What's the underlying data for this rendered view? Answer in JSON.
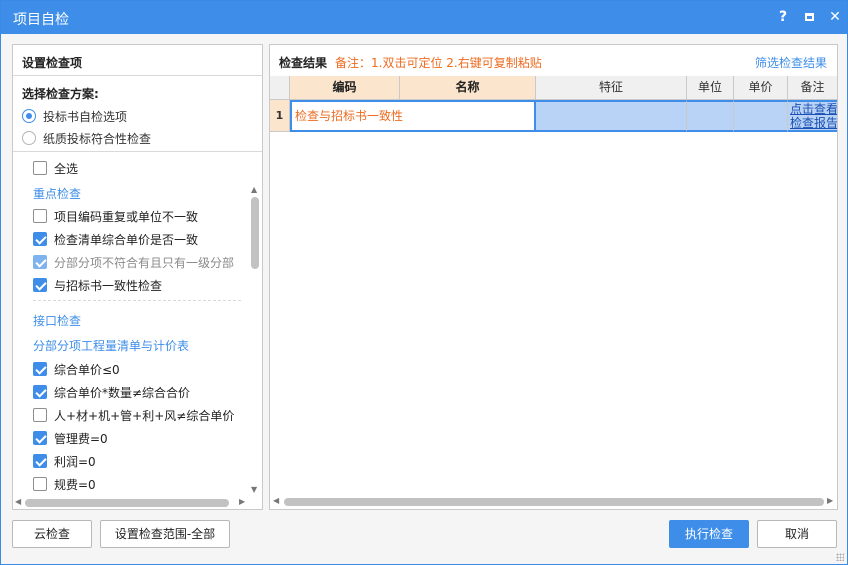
{
  "window": {
    "title": "项目自检",
    "help_label": "?",
    "close_label": "✕"
  },
  "left": {
    "header": "设置检查项",
    "scheme_label": "选择检查方案:",
    "schemes": [
      {
        "label": "投标书自检选项",
        "selected": true
      },
      {
        "label": "纸质投标符合性检查",
        "selected": false
      }
    ],
    "select_all": "全选",
    "key_section": "重点检查",
    "key_items": [
      {
        "label": "项目编码重复或单位不一致",
        "checked": false
      },
      {
        "label": "检查清单综合单价是否一致",
        "checked": true
      },
      {
        "label": "分部分项不符合有且只有一级分部",
        "checked": true,
        "disabled": true
      },
      {
        "label": "与招标书一致性检查",
        "checked": true
      }
    ],
    "interface_section": "接口检查",
    "sub_section": "分部分项工程量清单与计价表",
    "interface_items": [
      {
        "label": "综合单价≤0",
        "checked": true
      },
      {
        "label": "综合单价*数量≠综合合价",
        "checked": true
      },
      {
        "label": "人+材+机+管+利+风≠综合单价",
        "checked": false
      },
      {
        "label": "管理费=0",
        "checked": true
      },
      {
        "label": "利润=0",
        "checked": true
      },
      {
        "label": "规费=0",
        "checked": false
      }
    ]
  },
  "right": {
    "title": "检查结果",
    "note": "备注：1.双击可定位 2.右键可复制粘贴",
    "filter_link": "筛选检查结果",
    "columns": [
      "编码",
      "名称",
      "特征",
      "单位",
      "单价",
      "备注"
    ],
    "rows": [
      {
        "num": "1",
        "text": "检查与招标书一致性",
        "link1": "点击查看",
        "link2": "检查报告"
      }
    ]
  },
  "buttons": {
    "cloud": "云检查",
    "scope": "设置检查范围-全部",
    "run": "执行检查",
    "cancel": "取消"
  },
  "colors": {
    "accent": "#3e8ee9",
    "note": "#ee6b1f",
    "header_active": "#fbe5cc"
  }
}
